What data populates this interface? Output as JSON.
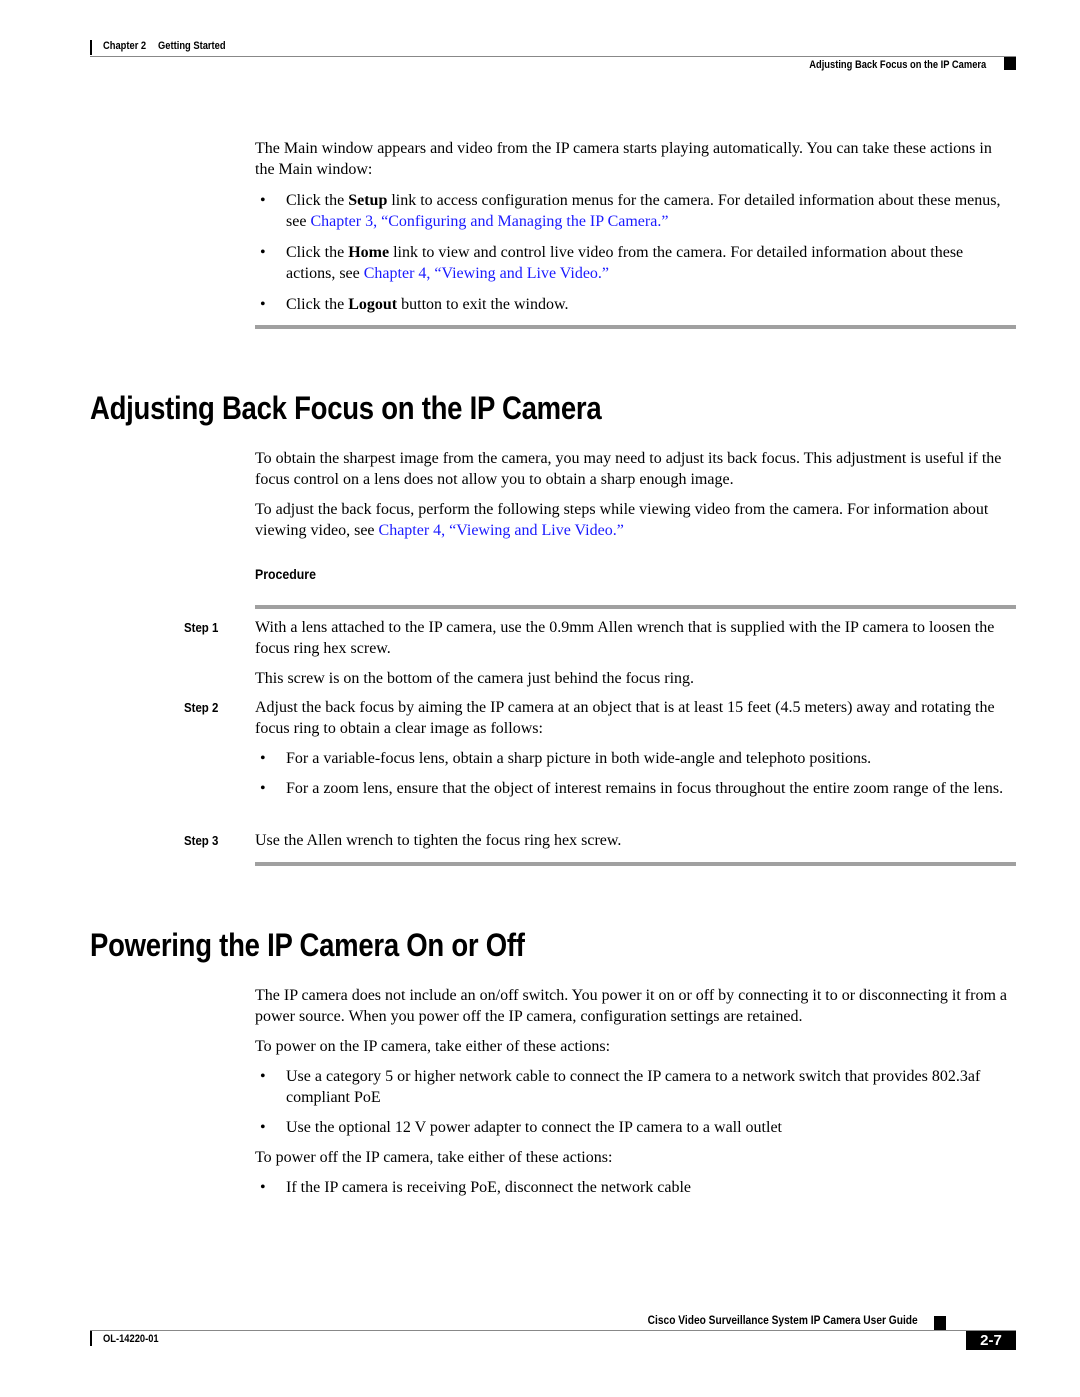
{
  "header": {
    "chapter_label": "Chapter 2",
    "chapter_title": "Getting Started",
    "section_title": "Adjusting Back Focus on the IP Camera"
  },
  "intro": {
    "paragraph": "The Main window appears and video from the IP camera starts playing automatically. You can take these actions in the Main window:",
    "bullets": [
      {
        "pre": "Click the ",
        "bold": "Setup",
        "post": " link to access configuration menus for the camera. For detailed information about these menus, see ",
        "link": "Chapter 3, “Configuring and Managing the IP Camera.”"
      },
      {
        "pre": "Click the ",
        "bold": "Home",
        "post": " link to view and control live video from the camera. For detailed information about these actions, see ",
        "link": "Chapter 4, “Viewing and Live Video.”"
      },
      {
        "pre": "Click the ",
        "bold": "Logout",
        "post": " button to exit the window.",
        "link": ""
      }
    ]
  },
  "section_back_focus": {
    "heading": "Adjusting Back Focus on the IP Camera",
    "para1": "To obtain the sharpest image from the camera, you may need to adjust its back focus. This adjustment is useful if the focus control on a lens does not allow you to obtain a sharp enough image.",
    "para2_pre": "To adjust the back focus, perform the following steps while viewing video from the camera. For information about viewing video, see ",
    "para2_link": "Chapter 4, “Viewing and Live Video.”",
    "procedure_label": "Procedure",
    "steps": [
      {
        "label": "Step 1",
        "text": "With a lens attached to the IP camera, use the 0.9mm Allen wrench that is supplied with the IP camera to loosen the focus ring hex screw.",
        "note": "This screw is on the bottom of the camera just behind the focus ring."
      },
      {
        "label": "Step 2",
        "text": "Adjust the back focus by aiming the IP camera at an object that is at least 15 feet (4.5 meters) away and rotating the focus ring to obtain a clear image as follows:",
        "bullets": [
          "For a variable-focus lens, obtain a sharp picture in both wide-angle and telephoto positions.",
          "For a zoom lens, ensure that the object of interest remains in focus throughout the entire zoom range of the lens."
        ]
      },
      {
        "label": "Step 3",
        "text": "Use the Allen wrench to tighten the focus ring hex screw."
      }
    ]
  },
  "section_power": {
    "heading": "Powering the IP Camera On or Off",
    "para1": "The IP camera does not include an on/off switch. You power it on or off by connecting it to or disconnecting it from a power source. When you power off the IP camera, configuration settings are retained.",
    "on_intro": "To power on the IP camera, take either of these actions:",
    "on_bullets": [
      "Use a category 5 or higher network cable to connect the IP camera to a network switch that provides 802.3af compliant PoE",
      "Use the optional 12 V power adapter to connect the IP camera to a wall outlet"
    ],
    "off_intro": "To power off the IP camera, take either of these actions:",
    "off_bullets": [
      "If the IP camera is receiving PoE, disconnect the network cable"
    ]
  },
  "footer": {
    "guide_title": "Cisco Video Surveillance System IP Camera User Guide",
    "doc_number": "OL-14220-01",
    "page_number": "2-7"
  },
  "bullet_glyph": "•"
}
